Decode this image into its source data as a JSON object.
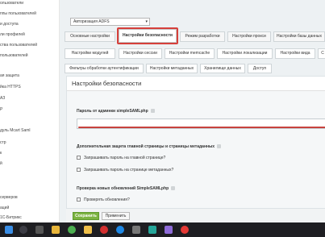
{
  "sidebar": {
    "items": [
      "ользователи",
      "ппы пользователей",
      "и доступа",
      "ли профилей",
      "ства пользователей",
      "пользователей",
      "ая защита",
      "йка HTTPS",
      "АЗ",
      "P",
      "дуль Mcart Saml",
      "стр",
      "к",
      "й",
      "",
      "серверов",
      "аций",
      "1С-Битрикс"
    ]
  },
  "auth_select": {
    "value": "Авторизация ADFS"
  },
  "tabs_row1": [
    "Основные настройки",
    "Настройки безопасности",
    "Режим разработки",
    "Настройки прокси",
    "Настройки базы данных"
  ],
  "tabs_row2": [
    "Настройки модулей",
    "Настройки сессии",
    "Настройки memcache",
    "Настройки локализации",
    "Настройки вида"
  ],
  "tabs_row3": [
    "Фильтры обработки аутентификации",
    "Настройки метаданных",
    "Хранилище данных",
    "Доступ"
  ],
  "panel": {
    "title": "Настройки безопасности",
    "password_label": "Пароль от админки simpleSAMLphp",
    "protection_heading": "Дополнительная защита главной страницы и страницы метаданных",
    "check_main": "Запрашивать пароль на главной странице?",
    "check_meta": "Запрашивать пароль на странице метаданных?",
    "updates_heading": "Проверка новых обновлений SimpleSAMLphp",
    "check_updates": "Проверять обновления?"
  },
  "footer": {
    "save": "Сохранить",
    "apply": "Применить"
  },
  "colors": {
    "accent_green": "#7cb342",
    "highlight_red": "#d6403b"
  },
  "taskbar_icons": [
    "windows-icon",
    "search-icon",
    "task-view-icon",
    "explorer-icon",
    "chrome-icon",
    "files-icon",
    "opera-icon",
    "edge-icon",
    "settings-icon",
    "app-icon",
    "app2-icon",
    "yandex-icon"
  ]
}
